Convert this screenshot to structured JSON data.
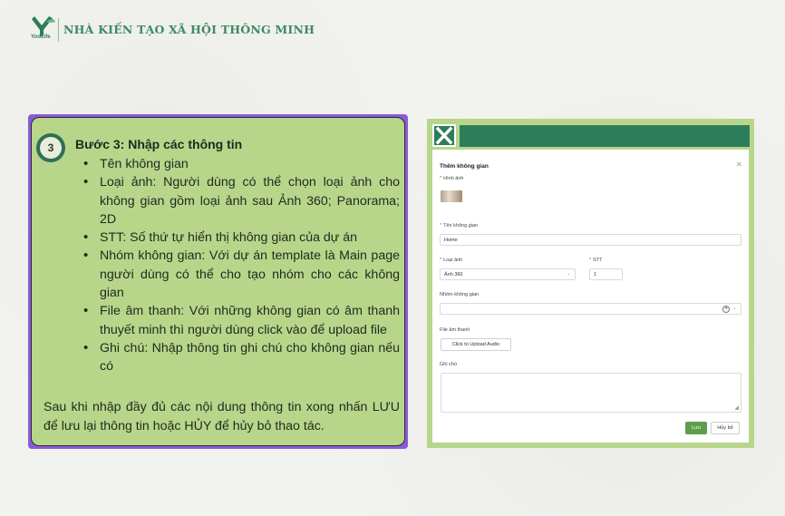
{
  "header": {
    "brand": "YooLife",
    "title": "NHÀ KIẾN TẠO XÃ HỘI THÔNG MINH"
  },
  "instructions": {
    "step_number": "3",
    "title": "Bước 3: Nhập các thông tin",
    "bullets": [
      "Tên không gian",
      "Loại ảnh: Người dùng có thể chọn loại ảnh cho không gian gồm loại ảnh sau Ảnh 360; Panorama; 2D",
      "STT: Số thứ tự hiển thị không gian của dự án",
      "Nhóm không gian: Với dự án template là Main page người dùng có thể cho tạo nhóm cho các không gian",
      "File âm thanh: Với những không gian có âm thanh thuyết minh thì người dùng click vào để upload file",
      "Ghi chú: Nhập thông tin ghi chú cho không gian nếu có"
    ],
    "summary": "Sau khi nhập đầy đủ các nội dung thông tin xong nhấn LƯU để lưu lại thông tin hoặc HỦY để hủy bỏ thao tác."
  },
  "modal": {
    "title": "Thêm không gian",
    "image_label": "Hình ảnh",
    "name_label": "Tên không gian",
    "name_value": "Home",
    "type_label": "Loại ảnh",
    "type_value": "Ảnh 360",
    "stt_label": "STT",
    "stt_value": "1",
    "group_label": "Nhóm không gian",
    "audio_label": "File âm thanh",
    "upload_label": "Click to Upload Audio",
    "note_label": "Ghi chú",
    "save_label": "Lưu",
    "cancel_label": "Hủy bỏ"
  },
  "colors": {
    "accent_green": "#2e7d5a",
    "panel_green": "#b7d68a",
    "panel_border": "#8a5ad8",
    "save_button": "#5e9e4b"
  }
}
